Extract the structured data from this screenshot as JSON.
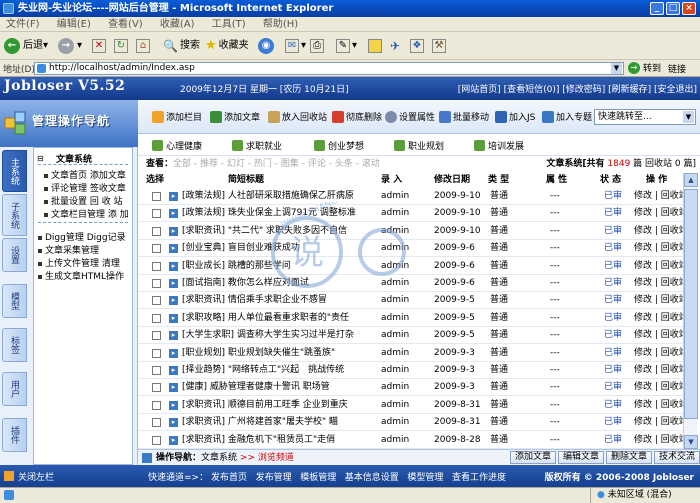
{
  "window": {
    "title": "失业网-失业论坛----网站后台管理 - Microsoft Internet Explorer"
  },
  "menu": [
    "文件(F)",
    "编辑(E)",
    "查看(V)",
    "收藏(A)",
    "工具(T)",
    "帮助(H)"
  ],
  "toolbar": {
    "back": "后退",
    "search": "搜索",
    "favorites": "收藏夹"
  },
  "address": {
    "label": "地址(D)",
    "url": "http://localhost/admin/Index.asp",
    "go": "转到",
    "links": "链接"
  },
  "header": {
    "logo": "Jobloser V5.52",
    "date": "2009年12月7日 星期一 [农历 10月21日]",
    "links": "[网站首页] [查看短信(0)] [修改密码] [刷新缓存] [安全退出]"
  },
  "nav": {
    "title": "管理操作导航",
    "tabs": [
      "主系统",
      "子系统",
      "设置",
      "模型",
      "标签",
      "用户",
      "插件"
    ],
    "section": "文章系统",
    "items": [
      [
        "文章首页",
        "添加文章"
      ],
      [
        "评论管理",
        "签收文章"
      ],
      [
        "批量设置",
        "回 收 站"
      ],
      [
        "文章栏目管理",
        "添 加"
      ]
    ],
    "items2": [
      [
        "Digg管理",
        "Digg记录"
      ],
      [
        "文章采集管理",
        ""
      ],
      [
        "上传文件管理",
        "清理"
      ],
      [
        "生成文章HTML操作",
        ""
      ]
    ],
    "close": "关闭左栏"
  },
  "actions": [
    "添加栏目",
    "添加文章",
    "放入回收站",
    "彻底删除",
    "设置属性",
    "批量移动",
    "加入JS",
    "加入专题"
  ],
  "quickjump": "快速跳转至...",
  "categories": [
    "心理健康",
    "求职就业",
    "创业梦想",
    "职业规划",
    "培训发展"
  ],
  "view": {
    "label": "查看：",
    "filters": "全部 - 推荐 - 幻灯 - 热门 - 图集 - 评论 - 头条 - 滚动",
    "stats_prefix": "文章系统[共有",
    "count": "1849",
    "stats_suffix": "篇 回收站 0 篇]"
  },
  "table": {
    "headers": [
      "选择",
      "简短标题",
      "录 入",
      "修改日期",
      "类 型",
      "属 性",
      "状 态",
      "操 作"
    ],
    "rows": [
      [
        "[政策法规] 人社部研采取措施确保乙肝病原",
        "admin",
        "2009-9-10",
        "普通",
        "---",
        "已审",
        "修改 | 回收站"
      ],
      [
        "[政策法规] 珠失业保金上调791元 调整标准",
        "admin",
        "2009-9-10",
        "普通",
        "---",
        "已审",
        "修改 | 回收站"
      ],
      [
        "[求职资讯] \"共二代\" 求职失败多因不自信",
        "admin",
        "2009-9-10",
        "普通",
        "---",
        "已审",
        "修改 | 回收站"
      ],
      [
        "[创业宝典] 盲目创业难获成功",
        "admin",
        "2009-9-6",
        "普通",
        "---",
        "已审",
        "修改 | 回收站"
      ],
      [
        "[职业成长] 跳槽的那些学问",
        "admin",
        "2009-9-6",
        "普通",
        "---",
        "已审",
        "修改 | 回收站"
      ],
      [
        "[面试指南] 教你怎么样应对面试",
        "admin",
        "2009-9-6",
        "普通",
        "---",
        "已审",
        "修改 | 回收站"
      ],
      [
        "[求职资讯] 情侣乘手求职企业不感冒",
        "admin",
        "2009-9-5",
        "普通",
        "---",
        "已审",
        "修改 | 回收站"
      ],
      [
        "[求职攻略] 用人单位最看重求职者的\"责任",
        "admin",
        "2009-9-5",
        "普通",
        "---",
        "已审",
        "修改 | 回收站"
      ],
      [
        "[大学生求职] 调查称大学生实习过半是打杂",
        "admin",
        "2009-9-5",
        "普通",
        "---",
        "已审",
        "修改 | 回收站"
      ],
      [
        "[职业规划] 职业规划缺失催生\"跳蚤族\"",
        "admin",
        "2009-9-3",
        "普通",
        "---",
        "已审",
        "修改 | 回收站"
      ],
      [
        "[择业趋势] \"网络转点工\"兴起　挑战传统",
        "admin",
        "2009-9-3",
        "普通",
        "---",
        "已审",
        "修改 | 回收站"
      ],
      [
        "[健康] 威胁管理者健康十警讯 职场管",
        "admin",
        "2009-9-3",
        "普通",
        "---",
        "已审",
        "修改 | 回收站"
      ],
      [
        "[求职资讯] 顺德目前用工旺季 企业到重庆",
        "admin",
        "2009-8-31",
        "普通",
        "---",
        "已审",
        "修改 | 回收站"
      ],
      [
        "[求职资讯] 广州将建首家\"屠夫学校\" 瞄",
        "admin",
        "2009-8-31",
        "普通",
        "---",
        "已审",
        "修改 | 回收站"
      ],
      [
        "[求职资讯] 金融危机下\"租赁员工\"走俏",
        "admin",
        "2009-8-28",
        "普通",
        "---",
        "已审",
        "修改 | 回收站"
      ]
    ]
  },
  "opbar": {
    "label": "操作导航：",
    "path": "文章系统",
    "sep": ">>",
    "current": "浏览频道",
    "buttons": [
      "添加文章",
      "编辑文章",
      "删除文章",
      "技术交流"
    ]
  },
  "footer": {
    "quick_label": "快速通道=>：",
    "links": [
      "发布首页",
      "发布管理",
      "模板管理",
      "基本信息设置",
      "模型管理",
      "查看工作进度"
    ],
    "copyright": "版权所有 © 2006-2008 Jobloser"
  },
  "status": {
    "zone": "未知区域 (混合)"
  },
  "watermark": {
    "text": "WWW.ZHANGEN",
    "mark": "说"
  }
}
